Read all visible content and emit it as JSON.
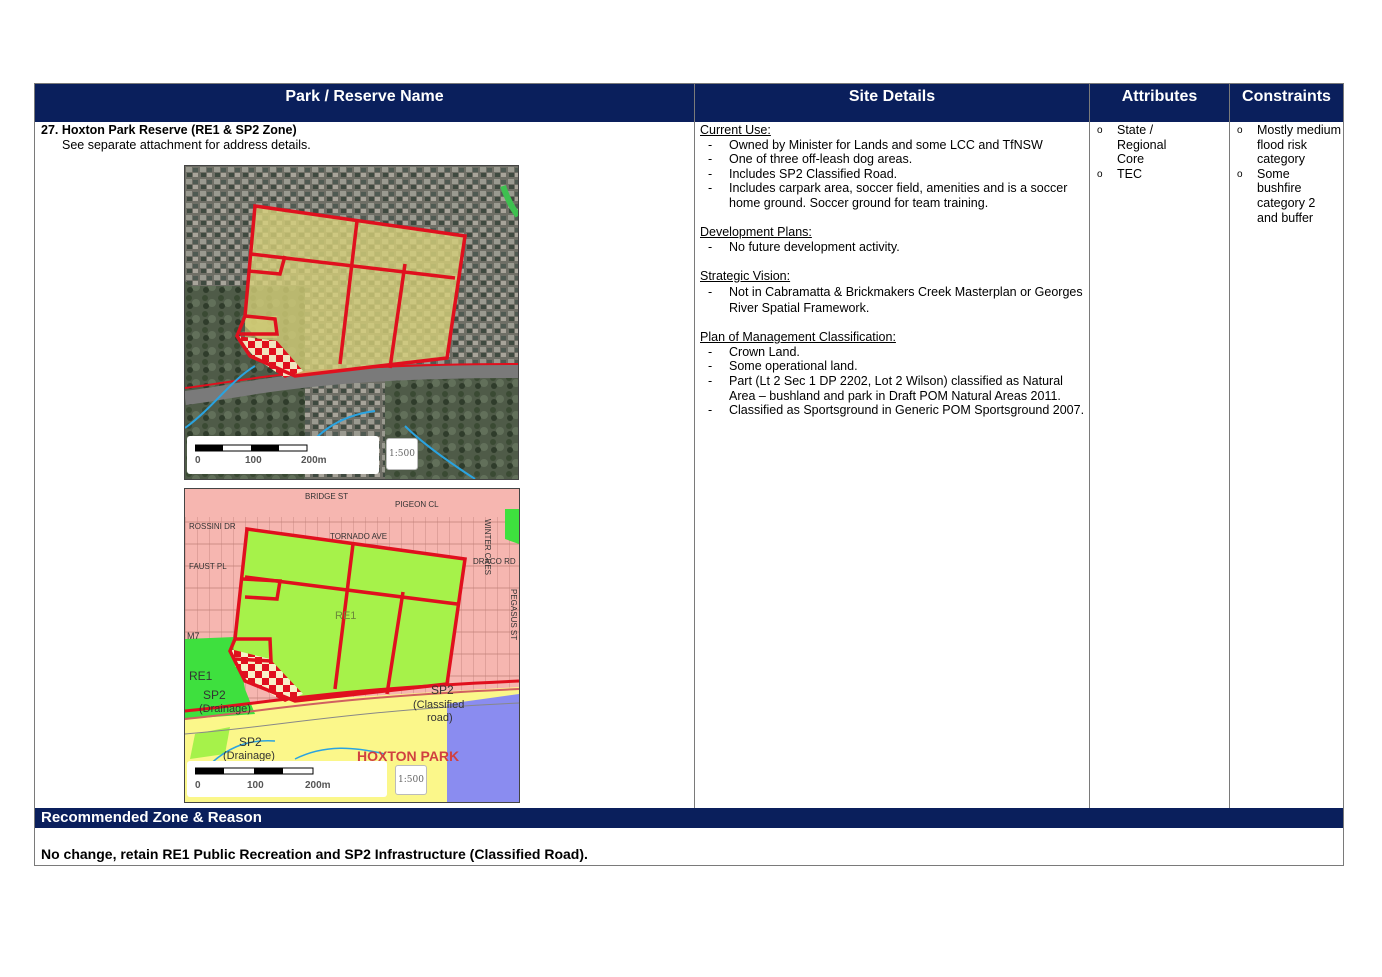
{
  "headers": {
    "park": "Park / Reserve Name",
    "site": "Site Details",
    "attributes": "Attributes",
    "constraints": "Constraints"
  },
  "park": {
    "title": "27. Hoxton Park Reserve (RE1 & SP2 Zone)",
    "subtitle": "See separate attachment for address details."
  },
  "maps": {
    "aerial": {
      "scale_labels": [
        "0",
        "100",
        "200m"
      ],
      "scale_button": "1:500",
      "faded_label": "",
      "colors": {
        "boundary": "#e0101e",
        "highlight": "#d8d27a"
      }
    },
    "zoning": {
      "zone_labels": [
        "RE1",
        "RE1",
        "SP2",
        "(Drainage)",
        "SP2",
        "(Drainage)",
        "SP2",
        "(Classified",
        "road)",
        "HOXTON PARK"
      ],
      "street_labels": [
        "ROSSINI DR",
        "BRIDGE ST",
        "FAUST PL",
        "PIGEON CL",
        "TORNADO AVE",
        "DRACO RD",
        "M7",
        "WINTER CRES",
        "PEGASUS ST"
      ],
      "scale_labels": [
        "0",
        "100",
        "200m"
      ],
      "scale_button": "1:500",
      "colors": {
        "residential": "#f6b6b0",
        "recreation": "#a6f24a",
        "infrastructure": "#fbf78a",
        "special": "#8a8cf0",
        "bushland": "#3ee03e"
      }
    }
  },
  "site_details": {
    "current_use": {
      "title": "Current Use:",
      "items": [
        "Owned by Minister for Lands and some LCC and TfNSW",
        "One of three off-leash dog areas.",
        "Includes SP2 Classified Road.",
        "Includes carpark area, soccer field, amenities and is a soccer home ground. Soccer ground for team training."
      ]
    },
    "development_plans": {
      "title": "Development Plans:",
      "items": [
        "No future development activity."
      ]
    },
    "strategic_vision": {
      "title": "Strategic Vision:",
      "items": [
        "Not in Cabramatta & Brickmakers Creek Masterplan or Georges River Spatial Framework."
      ]
    },
    "pom": {
      "title": "Plan of Management Classification:",
      "items": [
        "Crown Land.",
        "Some operational land.",
        "Part (Lt 2 Sec 1 DP 2202, Lot 2 Wilson) classified as Natural Area – bushland and park in Draft POM Natural Areas 2011.",
        "Classified as Sportsground in Generic POM Sportsground 2007."
      ]
    }
  },
  "attributes": [
    "State / Regional Core",
    "TEC"
  ],
  "constraints": [
    "Mostly medium flood risk category",
    "Some bushfire category 2 and buffer"
  ],
  "recommendation": {
    "title": "Recommended Zone & Reason",
    "text": "No change, retain RE1 Public Recreation and SP2 Infrastructure (Classified Road)."
  },
  "colors": {
    "header_bg": "#0a1f5c",
    "header_text": "#ffffff",
    "border": "#7a7a7a"
  }
}
